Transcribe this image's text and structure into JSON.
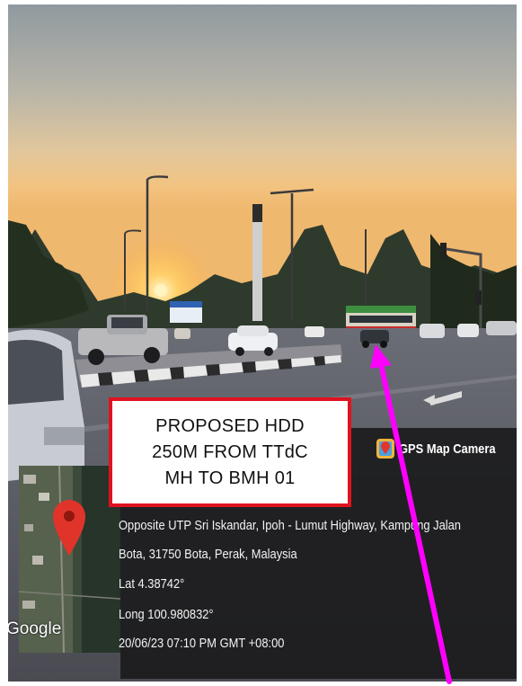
{
  "label": {
    "lines": [
      "PROPOSED HDD",
      "250M FROM TTdC",
      "MH TO BMH 01"
    ],
    "border_color": "#e0121f"
  },
  "stamp": {
    "app_name": "GPS Map Camera",
    "address_line1": "Opposite UTP Sri Iskandar, Ipoh - Lumut Highway, Kampung Jalan",
    "address_line2": "Bota, 31750 Bota, Perak, Malaysia",
    "latitude": "Lat 4.38742°",
    "longitude": "Long 100.980832°",
    "datetime": "20/06/23 07:10 PM GMT +08:00",
    "map_logo": "Google"
  },
  "annotation": {
    "arrow_color": "#ff00ff",
    "icon": "arrow-up-icon"
  }
}
